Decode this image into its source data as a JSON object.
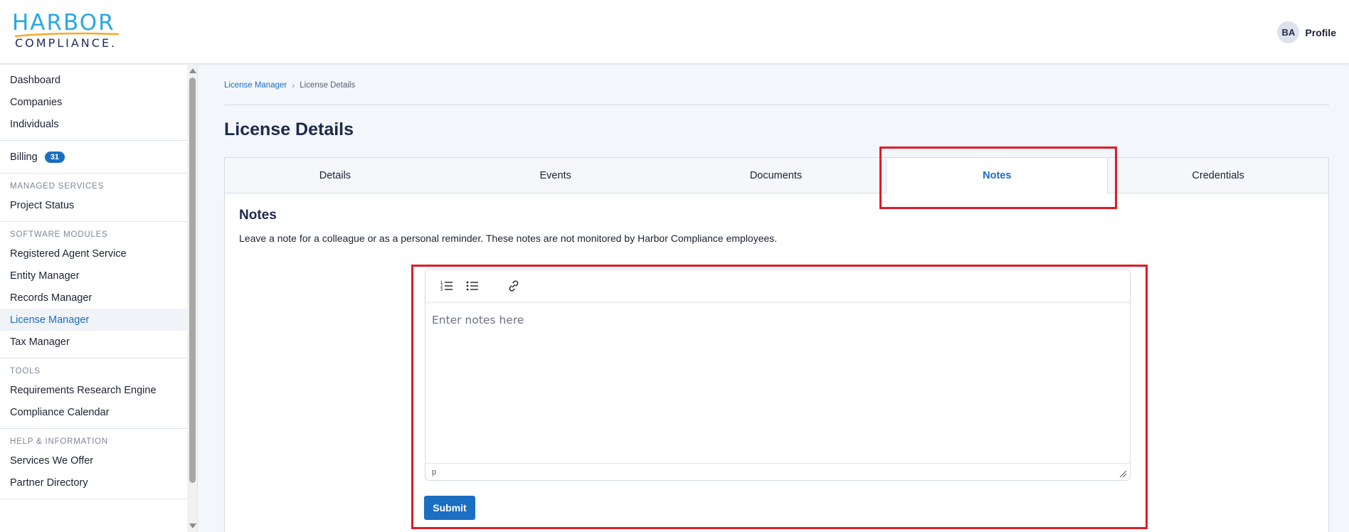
{
  "header": {
    "logo_top": "HARBOR",
    "logo_bottom": "COMPLIANCE.",
    "avatar_initials": "BA",
    "profile_label": "Profile"
  },
  "sidebar": {
    "items": [
      {
        "label": "Dashboard"
      },
      {
        "label": "Companies"
      },
      {
        "label": "Individuals"
      },
      {
        "label": "Billing",
        "badge": "31"
      },
      {
        "section": "MANAGED SERVICES"
      },
      {
        "label": "Project Status"
      },
      {
        "section": "SOFTWARE MODULES"
      },
      {
        "label": "Registered Agent Service"
      },
      {
        "label": "Entity Manager"
      },
      {
        "label": "Records Manager"
      },
      {
        "label": "License Manager",
        "active": true
      },
      {
        "label": "Tax Manager"
      },
      {
        "section": "TOOLS"
      },
      {
        "label": "Requirements Research Engine"
      },
      {
        "label": "Compliance Calendar"
      },
      {
        "section": "HELP & INFORMATION"
      },
      {
        "label": "Services We Offer"
      },
      {
        "label": "Partner Directory"
      }
    ]
  },
  "breadcrumb": {
    "parent": "License Manager",
    "separator": "›",
    "current": "License Details"
  },
  "page": {
    "title": "License Details"
  },
  "tabs": [
    {
      "label": "Details"
    },
    {
      "label": "Events"
    },
    {
      "label": "Documents"
    },
    {
      "label": "Notes",
      "active": true
    },
    {
      "label": "Credentials"
    }
  ],
  "notes": {
    "title": "Notes",
    "description": "Leave a note for a colleague or as a personal reminder. These notes are not monitored by Harbor Compliance employees.",
    "editor_placeholder": "Enter notes here",
    "status_path": "p",
    "submit_label": "Submit",
    "toolbar": [
      "ordered-list-icon",
      "bullet-list-icon",
      "link-icon"
    ]
  },
  "colors": {
    "accent": "#1b6ec2",
    "logo_blue": "#27a9e1",
    "logo_navy": "#1f2a5a",
    "highlight": "#e01b24"
  }
}
